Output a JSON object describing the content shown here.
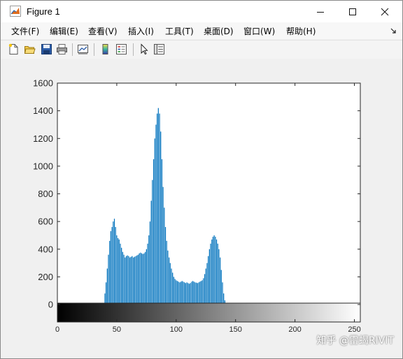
{
  "window": {
    "title": "Figure 1"
  },
  "menu": [
    "文件(F)",
    "编辑(E)",
    "查看(V)",
    "插入(I)",
    "工具(T)",
    "桌面(D)",
    "窗口(W)",
    "帮助(H)"
  ],
  "toolbar_icons": [
    "new-figure-icon",
    "open-file-icon",
    "save-icon",
    "print-icon",
    "link-plot-icon",
    "insert-colorbar-icon",
    "insert-legend-icon",
    "edit-plot-arrow-icon",
    "property-inspector-icon"
  ],
  "watermark": "知乎 @雷蝎RIVIT",
  "chart_data": {
    "type": "bar",
    "title": "",
    "xlabel": "",
    "ylabel": "",
    "xlim": [
      0,
      255
    ],
    "ylim": [
      0,
      1600
    ],
    "xticks": [
      0,
      50,
      100,
      150,
      200,
      250
    ],
    "yticks": [
      0,
      200,
      400,
      600,
      800,
      1000,
      1200,
      1400,
      1600
    ],
    "colorbar": "grayscale",
    "bar_color": "#0072bd",
    "x_start": 40,
    "values": [
      80,
      160,
      260,
      360,
      460,
      530,
      560,
      600,
      620,
      560,
      500,
      480,
      470,
      440,
      410,
      380,
      360,
      340,
      350,
      355,
      350,
      340,
      345,
      350,
      340,
      345,
      350,
      355,
      360,
      370,
      375,
      370,
      365,
      370,
      380,
      400,
      440,
      500,
      600,
      750,
      900,
      1050,
      1200,
      1300,
      1380,
      1420,
      1380,
      1250,
      1050,
      850,
      700,
      560,
      460,
      390,
      340,
      300,
      260,
      230,
      200,
      185,
      175,
      170,
      165,
      160,
      165,
      170,
      165,
      160,
      155,
      160,
      155,
      150,
      155,
      165,
      170,
      165,
      160,
      158,
      155,
      160,
      165,
      170,
      175,
      190,
      220,
      260,
      300,
      350,
      400,
      440,
      470,
      490,
      500,
      490,
      470,
      440,
      400,
      340,
      250,
      160,
      80,
      30,
      10
    ]
  },
  "axis_labels": {
    "y": [
      "0",
      "200",
      "400",
      "600",
      "800",
      "1000",
      "1200",
      "1400",
      "1600"
    ],
    "x": [
      "0",
      "50",
      "100",
      "150",
      "200",
      "250"
    ]
  }
}
